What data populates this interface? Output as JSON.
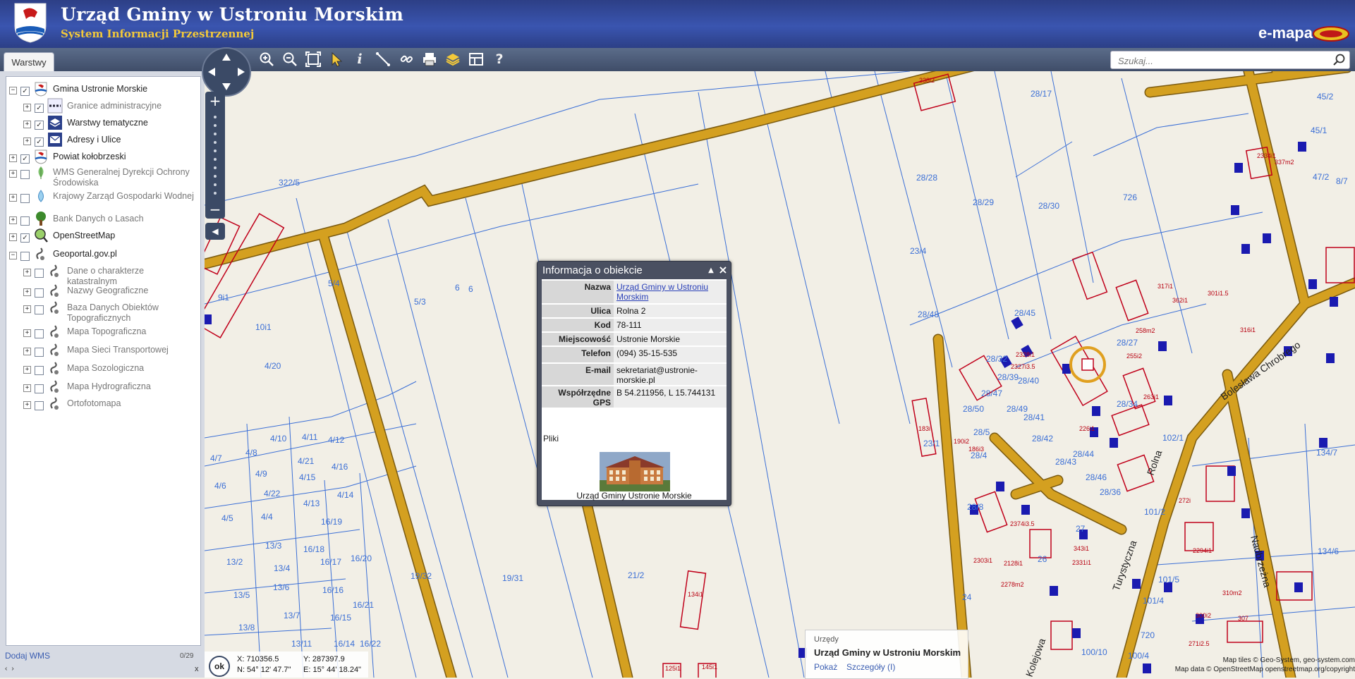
{
  "header": {
    "title": "Urząd Gminy w Ustroniu Morskim",
    "subtitle": "System Informacji Przestrzennej",
    "brand": "e-mapa",
    "colors": {
      "bar": "#3a55b0",
      "subtitle": "#f3c93a"
    }
  },
  "toolbar": {
    "tab": "Warstwy",
    "tools": [
      "zoom-in-icon",
      "zoom-out-icon",
      "zoom-extent-icon",
      "select-arrow-icon",
      "info-icon",
      "measure-distance-icon",
      "measure-link-icon",
      "print-icon",
      "layers-icon",
      "layout-icon",
      "help-icon"
    ],
    "search_placeholder": "Szukaj..."
  },
  "layers": [
    {
      "name": "Gmina Ustronie Morskie",
      "expanded": true,
      "checked": true,
      "level": 0,
      "icon": "coat-of-arms-icon",
      "dim": false
    },
    {
      "name": "Granice administracyjne",
      "expanded": false,
      "checked": true,
      "level": 1,
      "icon": "border-line-icon",
      "dim": true
    },
    {
      "name": "Warstwy tematyczne",
      "expanded": false,
      "checked": true,
      "level": 1,
      "icon": "stack-icon",
      "dim": false
    },
    {
      "name": "Adresy i Ulice",
      "expanded": false,
      "checked": true,
      "level": 1,
      "icon": "envelope-icon",
      "dim": false
    },
    {
      "name": "Powiat kołobrzeski",
      "expanded": false,
      "checked": true,
      "level": 0,
      "icon": "coat-of-arms-icon",
      "dim": false
    },
    {
      "name": "WMS Generalnej Dyrekcji Ochrony Środowiska",
      "expanded": false,
      "checked": false,
      "level": 0,
      "icon": "leaf-icon",
      "dim": true
    },
    {
      "name": "Krajowy Zarząd Gospodarki Wodnej",
      "expanded": false,
      "checked": false,
      "level": 0,
      "icon": "water-icon",
      "dim": true
    },
    {
      "name": "Bank Danych o Lasach",
      "expanded": false,
      "checked": false,
      "level": 0,
      "icon": "tree-icon",
      "dim": true
    },
    {
      "name": "OpenStreetMap",
      "expanded": false,
      "checked": true,
      "level": 0,
      "icon": "magnifier-map-icon",
      "dim": false
    },
    {
      "name": "Geoportal.gov.pl",
      "expanded": true,
      "checked": false,
      "level": 0,
      "icon": "geoportal-icon",
      "dim": false
    },
    {
      "name": "Dane o charakterze katastralnym",
      "expanded": false,
      "checked": false,
      "level": 1,
      "icon": "geoportal-icon",
      "dim": true
    },
    {
      "name": "Nazwy Geograficzne",
      "expanded": false,
      "checked": false,
      "level": 1,
      "icon": "geoportal-icon",
      "dim": true
    },
    {
      "name": "Baza Danych Obiektów Topograficznych",
      "expanded": false,
      "checked": false,
      "level": 1,
      "icon": "geoportal-icon",
      "dim": true
    },
    {
      "name": "Mapa Topograficzna",
      "expanded": false,
      "checked": false,
      "level": 1,
      "icon": "geoportal-icon",
      "dim": true
    },
    {
      "name": "Mapa Sieci Transportowej",
      "expanded": false,
      "checked": false,
      "level": 1,
      "icon": "geoportal-icon",
      "dim": true
    },
    {
      "name": "Mapa Sozologiczna",
      "expanded": false,
      "checked": false,
      "level": 1,
      "icon": "geoportal-icon",
      "dim": true
    },
    {
      "name": "Mapa Hydrograficzna",
      "expanded": false,
      "checked": false,
      "level": 1,
      "icon": "geoportal-icon",
      "dim": true
    },
    {
      "name": "Ortofotomapa",
      "expanded": false,
      "checked": false,
      "level": 1,
      "icon": "geoportal-icon",
      "dim": true
    }
  ],
  "sidebar_footer": {
    "add_wms": "Dodaj WMS",
    "count": "0/29",
    "prev": "‹",
    "next": "›",
    "close": "x"
  },
  "popup": {
    "title": "Informacja o obiekcie",
    "rows": [
      {
        "label": "Nazwa",
        "value": "Urząd Gminy w Ustroniu Morskim",
        "link": true
      },
      {
        "label": "Ulica",
        "value": "Rolna 2",
        "link": false
      },
      {
        "label": "Kod",
        "value": "78-111",
        "link": false
      },
      {
        "label": "Miejscowość",
        "value": "Ustronie Morskie",
        "link": false
      },
      {
        "label": "Telefon",
        "value": "(094) 35-15-535",
        "link": false
      },
      {
        "label": "E-mail",
        "value": "sekretariat@ustronie-morskie.pl",
        "link": false
      },
      {
        "label": "Współrzędne GPS",
        "value": "B 54.211956, L 15.744131",
        "link": false
      }
    ],
    "files_label": "Pliki",
    "photo_caption": "Urząd Gminy Ustronie Morskie"
  },
  "info_box": {
    "category": "Urzędy",
    "name": "Urząd Gminy w Ustroniu Morskim",
    "show": "Pokaż",
    "details": "Szczegóły (I)"
  },
  "coords": {
    "ok": "ok",
    "x": "X: 710356.5",
    "y": "Y: 287397.9",
    "n": "N: 54° 12' 47.7\"",
    "e": "E: 15° 44' 18.24\""
  },
  "attribution": {
    "tiles": "Map tiles © Geo-System, geo-system.com",
    "data": "Map data © OpenStreetMap openstreetmap.org/copyright"
  },
  "map": {
    "streets": [
      "Bolesława Chrobrego",
      "Rolna",
      "Turystyczna",
      "Kolejowa",
      "Nadbrzeżna"
    ],
    "parcels": [
      "322/5",
      "5/4",
      "5/3",
      "6",
      "4/20",
      "10i1",
      "9i1",
      "28/17",
      "28/28",
      "28/29",
      "28/30",
      "726",
      "23/4",
      "28/48",
      "28/45",
      "28/32",
      "28/50",
      "28/47",
      "28/49",
      "28/39",
      "28/40",
      "28/41",
      "28/42",
      "28/43",
      "28/44",
      "28/46",
      "28/36",
      "28/34",
      "28/27",
      "23/1",
      "28/4",
      "28/5",
      "28/8",
      "4/7",
      "4/8",
      "4/10",
      "4/11",
      "4/12",
      "4/6",
      "4/9",
      "4/21",
      "4/16",
      "4/15",
      "4/5",
      "4/4",
      "4/22",
      "4/13",
      "4/14",
      "16/19",
      "13/3",
      "13/2",
      "13/4",
      "16/18",
      "16/17",
      "16/20",
      "19/32",
      "19/31",
      "13/5",
      "13/6",
      "16/16",
      "13/8",
      "13/7",
      "16/15",
      "16/21",
      "13/11",
      "16/14",
      "16/22",
      "21/2",
      "24",
      "26",
      "27",
      "47/2",
      "45/2",
      "45/1",
      "101/2",
      "102/1",
      "134/7",
      "134/6",
      "100/4",
      "100/10",
      "101/4",
      "101/5",
      "720",
      "8/7",
      "6"
    ],
    "buildings": [
      "238i2",
      "183i",
      "190i2",
      "186i3",
      "2303i1",
      "2374i3.5",
      "2328i1",
      "2327i3.5",
      "255i2",
      "258m2",
      "263i1",
      "226i1",
      "362i1",
      "317i1",
      "301i1.5",
      "316i1",
      "134i1",
      "125i1",
      "145i1",
      "2128i1",
      "2278m2",
      "2294i1",
      "310m2",
      "307",
      "300i2",
      "271i2.5",
      "272i",
      "2334i1",
      "2331i1",
      "343i1",
      "337m2"
    ],
    "colors": {
      "road": "#d4a020",
      "parcel": "#3b6fd6",
      "building": "#c0001a",
      "address": "#1a1ab0"
    }
  }
}
